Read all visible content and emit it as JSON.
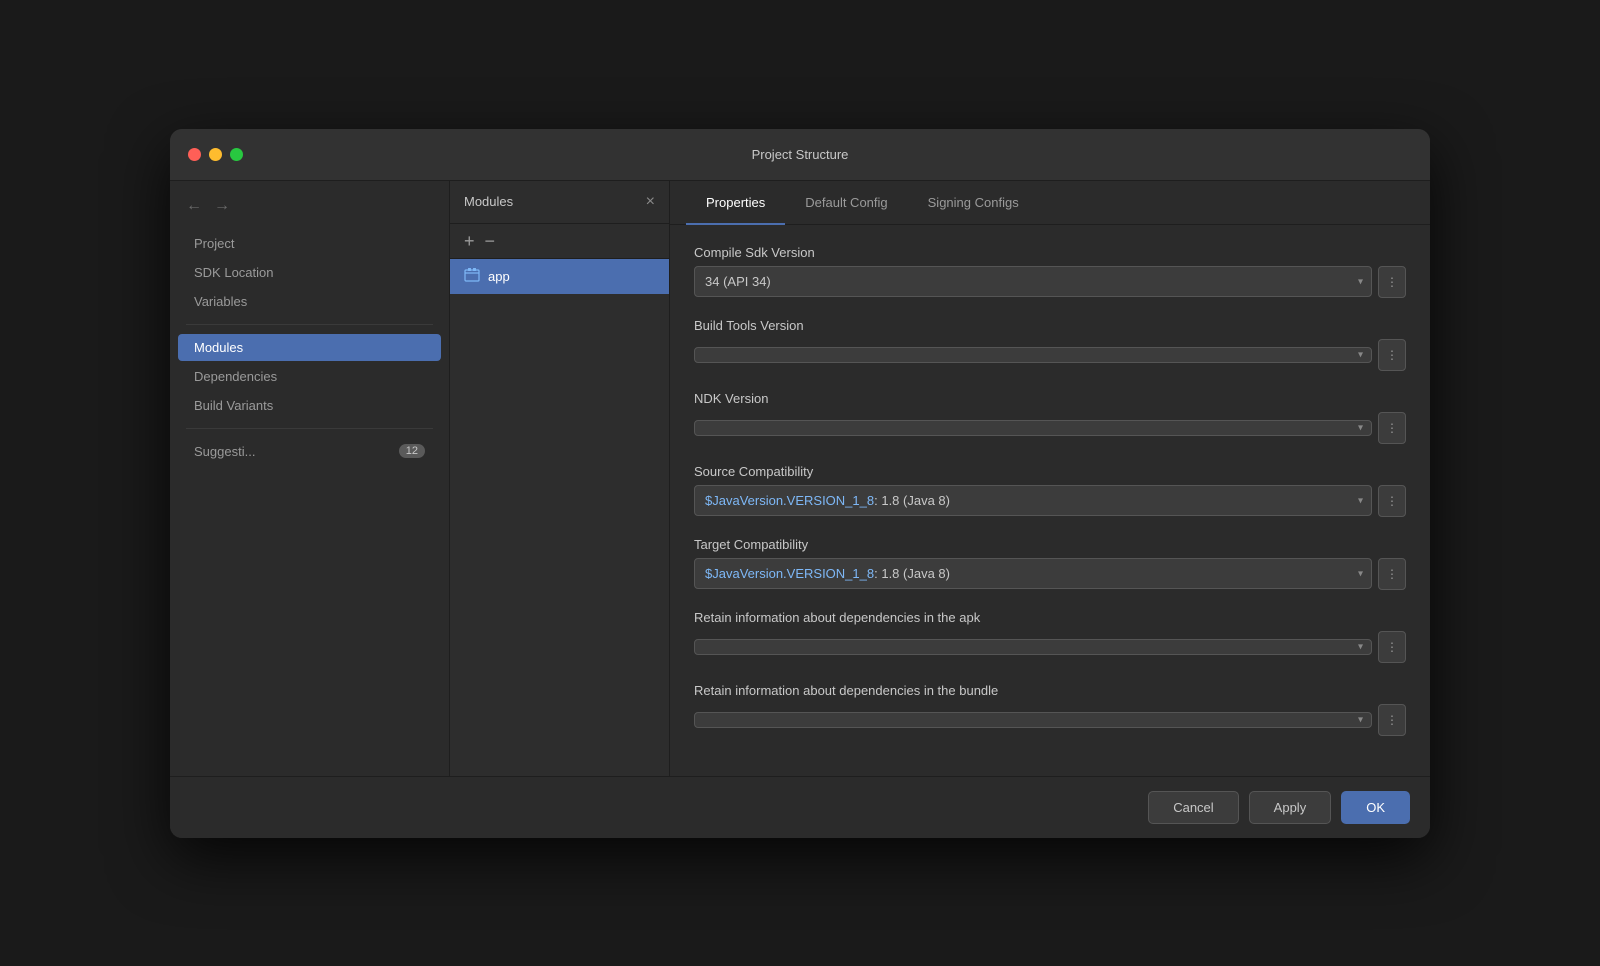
{
  "window": {
    "title": "Project Structure"
  },
  "sidebar": {
    "nav": {
      "back": "←",
      "forward": "→"
    },
    "items": [
      {
        "id": "project",
        "label": "Project",
        "active": false
      },
      {
        "id": "sdk-location",
        "label": "SDK Location",
        "active": false
      },
      {
        "id": "variables",
        "label": "Variables",
        "active": false
      }
    ],
    "active_section": "modules",
    "section_items": [
      {
        "id": "modules",
        "label": "Modules",
        "active": true
      },
      {
        "id": "dependencies",
        "label": "Dependencies",
        "active": false
      },
      {
        "id": "build-variants",
        "label": "Build Variants",
        "active": false
      }
    ],
    "suggestions": {
      "label": "Suggesti...",
      "badge": "12"
    }
  },
  "modules_panel": {
    "title": "Modules",
    "add_btn": "+",
    "remove_btn": "−",
    "close_btn": "×",
    "items": [
      {
        "id": "app",
        "label": "app",
        "icon": "📁"
      }
    ]
  },
  "tabs": [
    {
      "id": "properties",
      "label": "Properties",
      "active": true
    },
    {
      "id": "default-config",
      "label": "Default Config",
      "active": false
    },
    {
      "id": "signing-configs",
      "label": "Signing Configs",
      "active": false
    }
  ],
  "fields": [
    {
      "id": "compile-sdk-version",
      "label": "Compile Sdk Version",
      "value": "34 (API 34)",
      "java_ref": null,
      "placeholder": ""
    },
    {
      "id": "build-tools-version",
      "label": "Build Tools Version",
      "value": "",
      "java_ref": null,
      "placeholder": ""
    },
    {
      "id": "ndk-version",
      "label": "NDK Version",
      "value": "",
      "java_ref": null,
      "placeholder": ""
    },
    {
      "id": "source-compatibility",
      "label": "Source Compatibility",
      "value": ": 1.8 (Java 8)",
      "java_ref": "$JavaVersion.VERSION_1_8",
      "placeholder": ""
    },
    {
      "id": "target-compatibility",
      "label": "Target Compatibility",
      "value": ": 1.8 (Java 8)",
      "java_ref": "$JavaVersion.VERSION_1_8",
      "placeholder": ""
    },
    {
      "id": "retain-apk",
      "label": "Retain information about dependencies in the apk",
      "value": "",
      "java_ref": null,
      "placeholder": ""
    },
    {
      "id": "retain-bundle",
      "label": "Retain information about dependencies in the bundle",
      "value": "",
      "java_ref": null,
      "placeholder": ""
    }
  ],
  "buttons": {
    "cancel": "Cancel",
    "apply": "Apply",
    "ok": "OK"
  }
}
